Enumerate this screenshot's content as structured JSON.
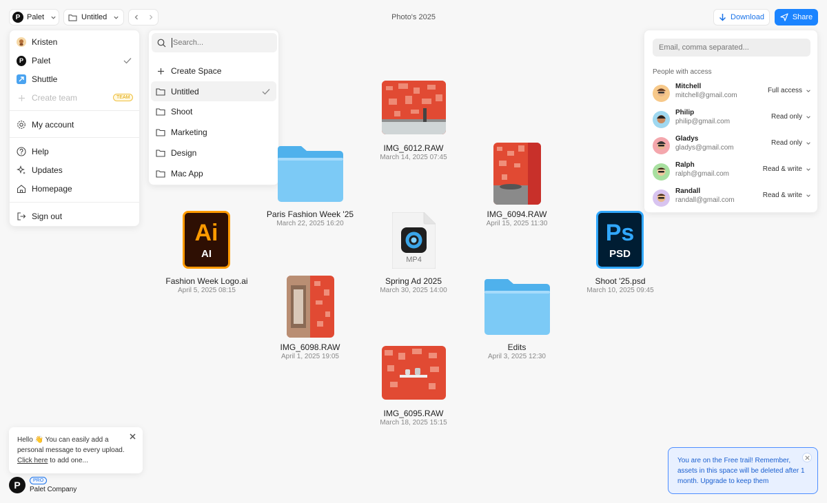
{
  "topbar": {
    "workspace_label": "Palet",
    "space_label": "Untitled",
    "title": "Photo's 2025",
    "download_label": "Download",
    "share_label": "Share"
  },
  "workspace_menu": {
    "items": [
      {
        "label": "Kristen"
      },
      {
        "label": "Palet"
      },
      {
        "label": "Shuttle"
      },
      {
        "label": "Create team"
      }
    ],
    "team_badge": "TEAM",
    "my_account": "My account",
    "help": "Help",
    "updates": "Updates",
    "homepage": "Homepage",
    "sign_out": "Sign out"
  },
  "space_menu": {
    "search_placeholder": "Search...",
    "create_label": "Create Space",
    "spaces": [
      {
        "label": "Untitled"
      },
      {
        "label": "Shoot"
      },
      {
        "label": "Marketing"
      },
      {
        "label": "Design"
      },
      {
        "label": "Mac App"
      }
    ]
  },
  "files": [
    {
      "name": "IMG_6012.RAW",
      "date": "March 14, 2025 07:45",
      "kind": "image"
    },
    {
      "name": "Paris Fashion Week '25",
      "date": "March 22, 2025 16:20",
      "kind": "folder"
    },
    {
      "name": "IMG_6094.RAW",
      "date": "April 15, 2025 11:30",
      "kind": "image"
    },
    {
      "name": "Fashion Week Logo.ai",
      "date": "April 5, 2025 08:15",
      "kind": "ai",
      "badge": "Ai",
      "sub": "AI"
    },
    {
      "name": "Spring Ad 2025",
      "date": "March 30, 2025 14:00",
      "kind": "mp4",
      "sub": "MP4"
    },
    {
      "name": "Shoot '25.psd",
      "date": "March 10, 2025 09:45",
      "kind": "psd",
      "badge": "Ps",
      "sub": "PSD"
    },
    {
      "name": "IMG_6098.RAW",
      "date": "April 1, 2025 19:05",
      "kind": "image"
    },
    {
      "name": "Edits",
      "date": "April 3, 2025 12:30",
      "kind": "folder"
    },
    {
      "name": "IMG_6095.RAW",
      "date": "March 18, 2025 15:15",
      "kind": "image"
    }
  ],
  "share_panel": {
    "email_placeholder": "Email, comma separated...",
    "people_title": "People with access",
    "people": [
      {
        "name": "Mitchell",
        "email": "mitchell@gmail.com",
        "permission": "Full access",
        "color": "#f7c98a"
      },
      {
        "name": "Philip",
        "email": "philip@gmail.com",
        "permission": "Read only",
        "color": "#9fd8f0"
      },
      {
        "name": "Gladys",
        "email": "gladys@gmail.com",
        "permission": "Read only",
        "color": "#f4a7ad"
      },
      {
        "name": "Ralph",
        "email": "ralph@gmail.com",
        "permission": "Read & write",
        "color": "#a8e0a0"
      },
      {
        "name": "Randall",
        "email": "randall@gmail.com",
        "permission": "Read & write",
        "color": "#d8c4f0"
      }
    ]
  },
  "message_toast": {
    "text_before": "Hello 👋 You can easily add a personal message to every upload. ",
    "link": "Click here",
    "text_after": " to add one..."
  },
  "account": {
    "badge": "PRO",
    "name": "Palet Company"
  },
  "trial_toast": {
    "text": "You are on the Free trail! Remember, assets in this space will be deleted after 1 month. Upgrade to keep them"
  },
  "colors": {
    "accent": "#1b84ff",
    "folder": "#7cc8f5",
    "photo_red": "#e8452f"
  }
}
